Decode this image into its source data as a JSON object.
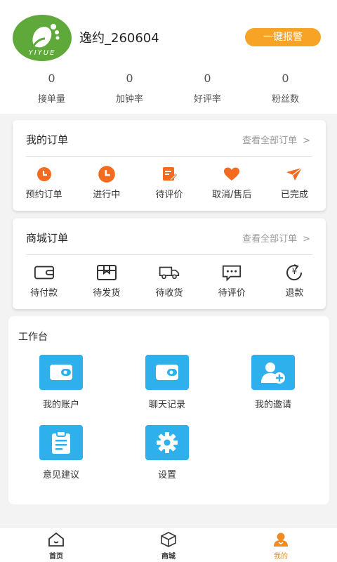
{
  "profile": {
    "avatar_brand": "YIYUE",
    "username": "逸约_260604",
    "alarm_button": "一键报警",
    "stats": [
      {
        "value": "0",
        "label": "接单量"
      },
      {
        "value": "0",
        "label": "加钟率"
      },
      {
        "value": "0",
        "label": "好评率"
      },
      {
        "value": "0",
        "label": "粉丝数"
      }
    ]
  },
  "my_orders": {
    "title": "我的订单",
    "view_all": "查看全部订单",
    "chevron": ">",
    "items": [
      {
        "label": "预约订单",
        "icon": "clock-icon"
      },
      {
        "label": "进行中",
        "icon": "clock-icon"
      },
      {
        "label": "待评价",
        "icon": "edit-icon"
      },
      {
        "label": "取消/售后",
        "icon": "heart-icon"
      },
      {
        "label": "已完成",
        "icon": "plane-icon"
      }
    ],
    "accent": "#f46a1f"
  },
  "mall_orders": {
    "title": "商城订单",
    "view_all": "查看全部订单",
    "chevron": ">",
    "items": [
      {
        "label": "待付款",
        "icon": "wallet-icon"
      },
      {
        "label": "待发货",
        "icon": "box-icon"
      },
      {
        "label": "待收货",
        "icon": "truck-icon"
      },
      {
        "label": "待评价",
        "icon": "chat-icon"
      },
      {
        "label": "退款",
        "icon": "refund-icon"
      }
    ],
    "refund_symbol": "¥"
  },
  "workbench": {
    "title": "工作台",
    "items": [
      {
        "label": "我的账户",
        "icon": "wallet-icon"
      },
      {
        "label": "聊天记录",
        "icon": "wallet-icon"
      },
      {
        "label": "我的邀请",
        "icon": "add-user-icon"
      },
      {
        "label": "意见建议",
        "icon": "clipboard-icon"
      },
      {
        "label": "设置",
        "icon": "gear-icon"
      }
    ],
    "tile_color": "#2db0ec"
  },
  "tabbar": {
    "tabs": [
      {
        "label": "首页",
        "icon": "home-icon",
        "active": false
      },
      {
        "label": "商城",
        "icon": "cube-icon",
        "active": false
      },
      {
        "label": "我的",
        "icon": "person-icon",
        "active": true
      }
    ],
    "active_color": "#f08a24"
  }
}
